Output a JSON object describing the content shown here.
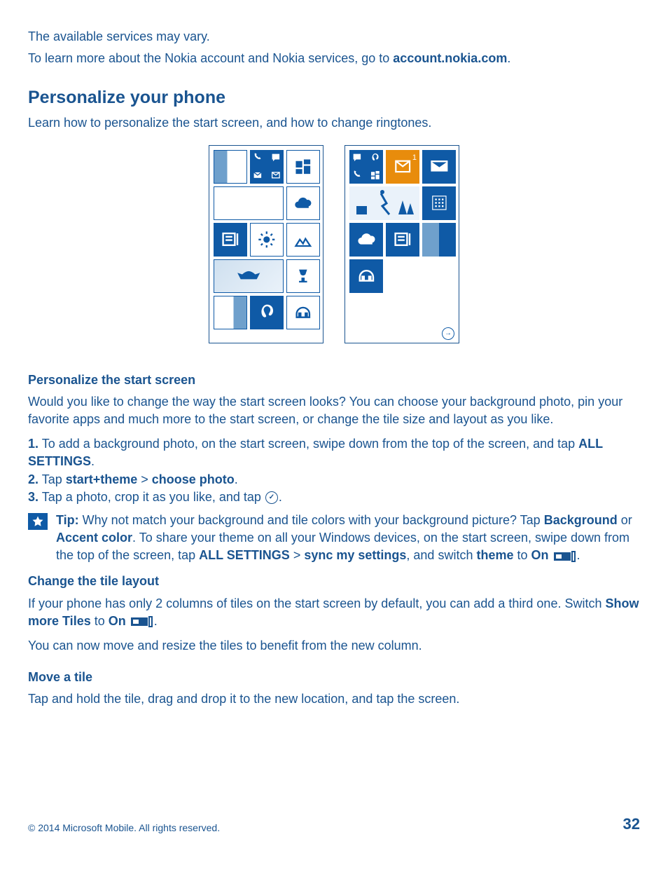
{
  "intro": {
    "line1": "The available services may vary.",
    "line2_prefix": "To learn more about the Nokia account and Nokia services, go to ",
    "line2_link": "account.nokia.com",
    "line2_suffix": "."
  },
  "section": {
    "title": "Personalize your phone",
    "subtitle": "Learn how to personalize the start screen, and how to change ringtones."
  },
  "personalize": {
    "heading": "Personalize the start screen",
    "body": "Would you like to change the way the start screen looks? You can choose your background photo, pin your favorite apps and much more to the start screen, or change the tile size and layout as you like.",
    "step1_num": "1.",
    "step1_text": " To add a background photo, on the start screen, swipe down from the top of the screen, and tap ",
    "step1_bold": "ALL SETTINGS",
    "step1_end": ".",
    "step2_num": "2.",
    "step2_a": " Tap ",
    "step2_b": "start+theme",
    "step2_c": " > ",
    "step2_d": "choose photo",
    "step2_e": ".",
    "step3_num": "3.",
    "step3_a": " Tap a photo, crop it as you like, and tap ",
    "step3_b": "."
  },
  "tip": {
    "label": "Tip:",
    "a": " Why not match your background and tile colors with your background picture? Tap ",
    "b": "Background",
    "c": " or ",
    "d": "Accent color",
    "e": ". To share your theme on all your Windows devices, on the start screen, swipe down from the top of the screen, tap ",
    "f": "ALL SETTINGS",
    "g": " > ",
    "h": "sync my settings",
    "i": ", and switch ",
    "j": "theme",
    "k": " to ",
    "l": "On",
    "m": " ",
    "n": "."
  },
  "change": {
    "heading": "Change the tile layout",
    "line1": "If your phone has only 2 columns of tiles on the start screen by default, you can add a third one. Switch ",
    "bold1": "Show more Tiles",
    "mid": " to ",
    "bold2": "On",
    "end": ".",
    "line2": "You can now move and resize the tiles to benefit from the new column."
  },
  "move": {
    "heading": "Move a tile",
    "body": "Tap and hold the tile, drag and drop it to the new location, and tap the screen."
  },
  "footer": {
    "copyright": "© 2014 Microsoft Mobile. All rights reserved.",
    "page": "32"
  }
}
